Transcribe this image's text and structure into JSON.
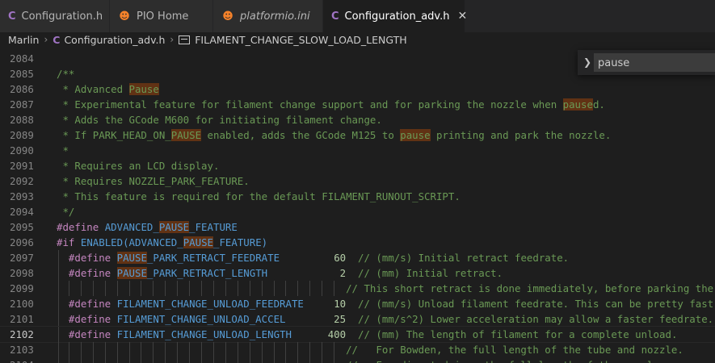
{
  "tabs": [
    {
      "icon": "C",
      "label": "Configuration.h",
      "italic": false,
      "active": false
    },
    {
      "icon": "PIO",
      "label": "PIO Home",
      "italic": false,
      "active": false
    },
    {
      "icon": "PIO",
      "label": "platformio.ini",
      "italic": true,
      "active": false
    },
    {
      "icon": "C",
      "label": "Configuration_adv.h",
      "italic": false,
      "active": true
    }
  ],
  "close_glyph": "✕",
  "breadcrumb": {
    "folder": "Marlin",
    "file": "Configuration_adv.h",
    "symbol": "FILAMENT_CHANGE_SLOW_LOAD_LENGTH"
  },
  "find": {
    "value": "pause"
  },
  "current_line": "2102",
  "lines": [
    {
      "n": "2084",
      "code": ""
    },
    {
      "n": "2085",
      "code": "/**"
    },
    {
      "n": "2086",
      "code": " * Advanced Pause"
    },
    {
      "n": "2087",
      "code": " * Experimental feature for filament change support and for parking the nozzle when paused."
    },
    {
      "n": "2088",
      "code": " * Adds the GCode M600 for initiating filament change."
    },
    {
      "n": "2089",
      "code": " * If PARK_HEAD_ON_PAUSE enabled, adds the GCode M125 to pause printing and park the nozzle."
    },
    {
      "n": "2090",
      "code": " *"
    },
    {
      "n": "2091",
      "code": " * Requires an LCD display."
    },
    {
      "n": "2092",
      "code": " * Requires NOZZLE_PARK_FEATURE."
    },
    {
      "n": "2093",
      "code": " * This feature is required for the default FILAMENT_RUNOUT_SCRIPT."
    },
    {
      "n": "2094",
      "code": " */"
    },
    {
      "n": "2095",
      "code": "#define ADVANCED_PAUSE_FEATURE"
    },
    {
      "n": "2096",
      "code": "#if ENABLED(ADVANCED_PAUSE_FEATURE)"
    },
    {
      "n": "2097",
      "code": "  #define PAUSE_PARK_RETRACT_FEEDRATE         60  // (mm/s) Initial retract feedrate."
    },
    {
      "n": "2098",
      "code": "  #define PAUSE_PARK_RETRACT_LENGTH            2  // (mm) Initial retract."
    },
    {
      "n": "2099",
      "code": "                                                // This short retract is done immediately, before parking the nozzle."
    },
    {
      "n": "2100",
      "code": "  #define FILAMENT_CHANGE_UNLOAD_FEEDRATE     10  // (mm/s) Unload filament feedrate. This can be pretty fast."
    },
    {
      "n": "2101",
      "code": "  #define FILAMENT_CHANGE_UNLOAD_ACCEL        25  // (mm/s^2) Lower acceleration may allow a faster feedrate."
    },
    {
      "n": "2102",
      "code": "  #define FILAMENT_CHANGE_UNLOAD_LENGTH      400  // (mm) The length of filament for a complete unload."
    },
    {
      "n": "2103",
      "code": "                                                //   For Bowden, the full length of the tube and nozzle."
    },
    {
      "n": "2104",
      "code": "                                                //   For direct drive, the full length of the nozzle."
    }
  ]
}
